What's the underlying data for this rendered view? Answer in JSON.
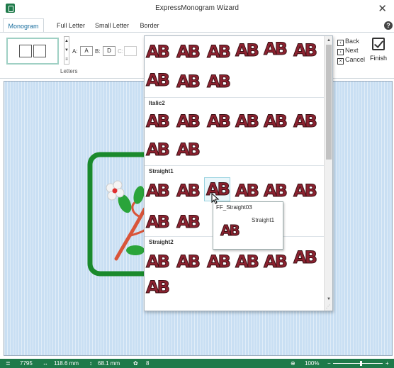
{
  "window": {
    "title": "ExpressMonogram Wizard",
    "close": "✕"
  },
  "tabs": [
    {
      "label": "Monogram"
    },
    {
      "label": "Full Letter"
    },
    {
      "label": "Small Letter"
    },
    {
      "label": "Border"
    }
  ],
  "help": "?",
  "ribbon": {
    "letters_caption": "Letters",
    "a_label": "A:",
    "a_value": "A",
    "b_label": "B:",
    "b_value": "D",
    "c_label": "C:",
    "c_value": "",
    "back": "Back",
    "next": "Next",
    "cancel": "Cancel",
    "finish": "Finish"
  },
  "gallery": {
    "sample": "AB",
    "sections": [
      {
        "title": "Italic2"
      },
      {
        "title": "Straight1"
      },
      {
        "title": "Straight2"
      }
    ],
    "tooltip": {
      "name": "FF_Straight03",
      "style": "Straight1"
    }
  },
  "status": {
    "stitches": "7795",
    "width": "118.6 mm",
    "height": "68.1 mm",
    "colors": "8",
    "zoom": "100%",
    "minus": "−",
    "plus": "+"
  },
  "colors": {
    "accent": "#1e7a4a",
    "letter": "#8c2230"
  }
}
